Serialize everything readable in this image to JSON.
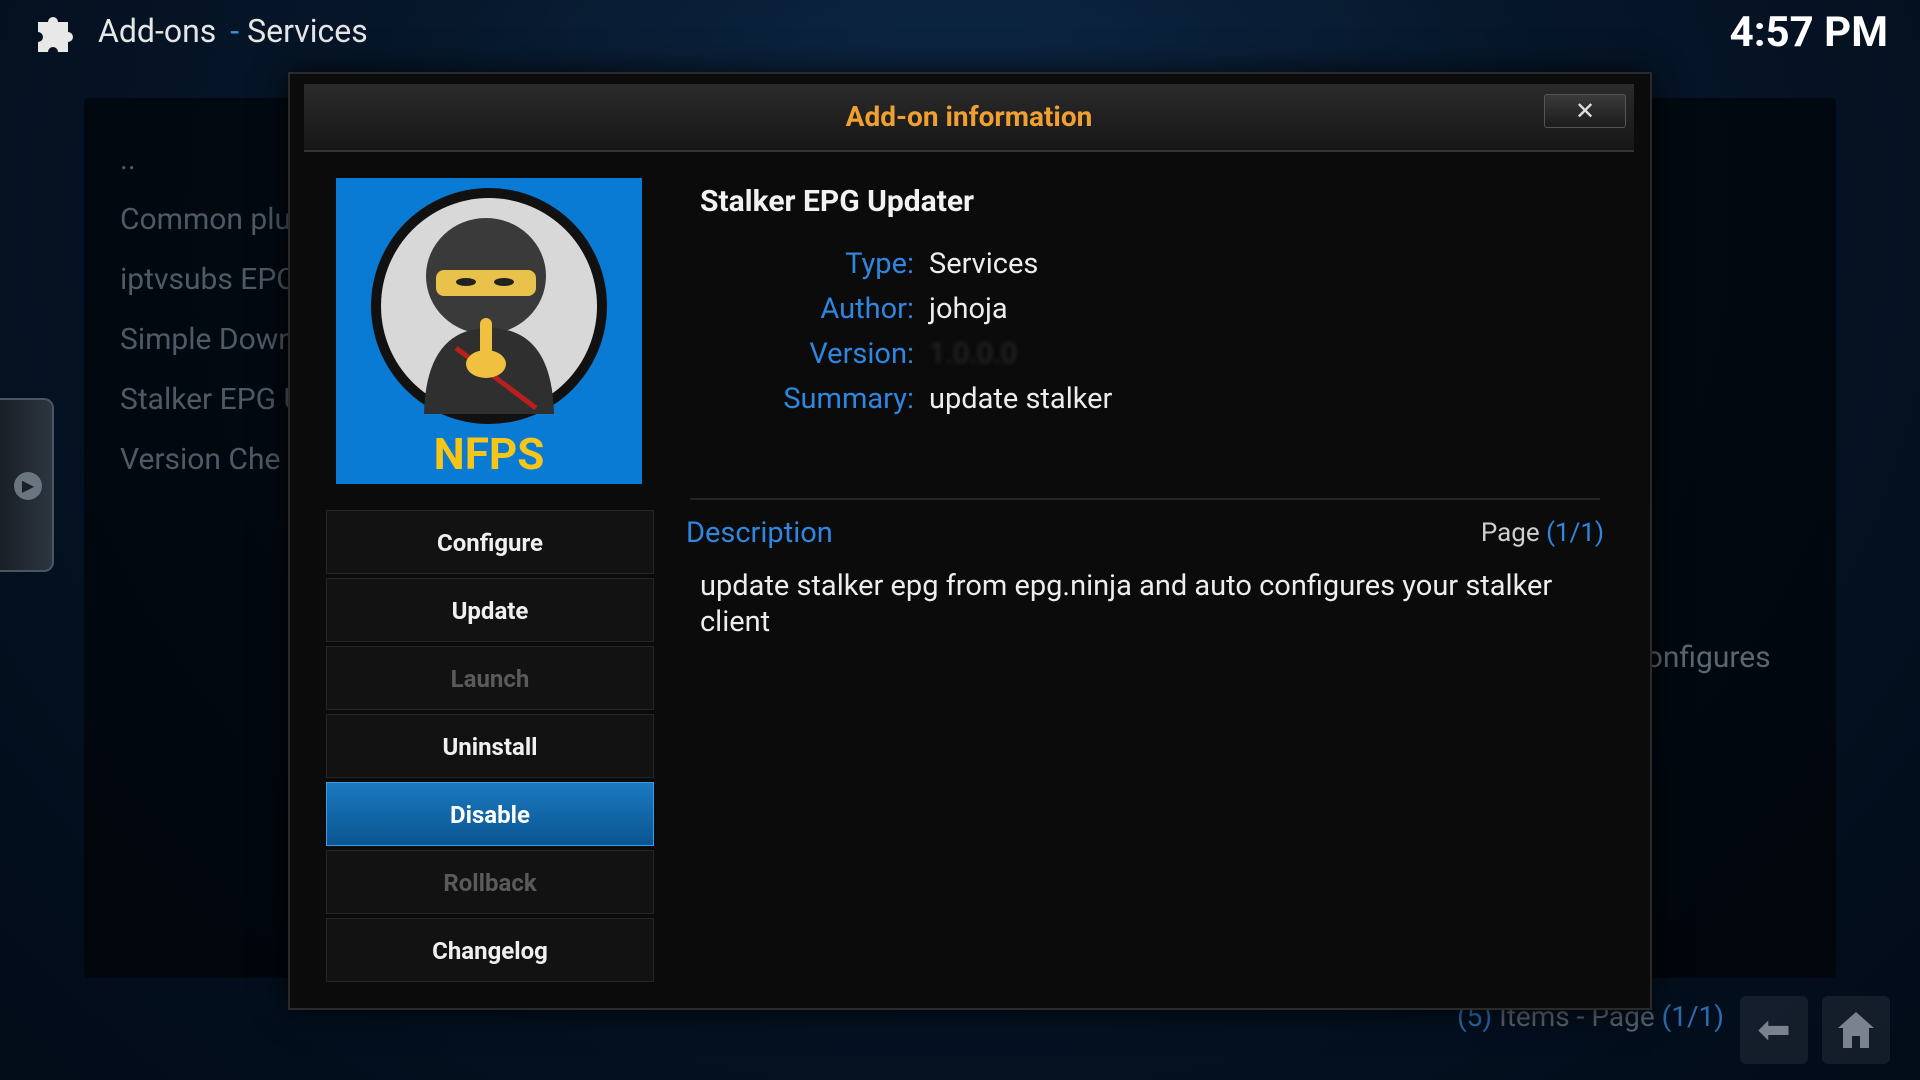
{
  "header": {
    "section": "Add-ons",
    "separator": "-",
    "subsection": "Services",
    "clock": "4:57 PM",
    "icon": "puzzle-piece-icon"
  },
  "background": {
    "list_items": [
      "..",
      "Common plu",
      "iptvsubs EPC",
      "Simple Down",
      "Stalker EPG U",
      "Version Che"
    ],
    "desc_fragment": "configures",
    "footer": {
      "count": "(5)",
      "items_text": "Items - Page",
      "page": "(1/1)"
    }
  },
  "dialog": {
    "title": "Add-on information",
    "close_label": "✕",
    "icon_text": "NFPS",
    "addon_name": "Stalker EPG Updater",
    "meta": {
      "type_label": "Type:",
      "type_value": "Services",
      "author_label": "Author:",
      "author_value": "johoja",
      "version_label": "Version:",
      "version_value": "1.0.0.0",
      "summary_label": "Summary:",
      "summary_value": "update stalker"
    },
    "description_label": "Description",
    "page_prefix": "Page",
    "page_value": "(1/1)",
    "description": "update stalker epg from epg.ninja and auto configures your stalker client",
    "buttons": [
      {
        "label": "Configure",
        "state": "enabled"
      },
      {
        "label": "Update",
        "state": "enabled"
      },
      {
        "label": "Launch",
        "state": "disabled"
      },
      {
        "label": "Uninstall",
        "state": "enabled"
      },
      {
        "label": "Disable",
        "state": "focused"
      },
      {
        "label": "Rollback",
        "state": "disabled"
      },
      {
        "label": "Changelog",
        "state": "enabled"
      }
    ]
  },
  "colors": {
    "accent_blue": "#2f86de",
    "title_orange": "#f0a030",
    "focus_blue": "#1b79c0",
    "icon_bg": "#0a7bd4",
    "nfps_yellow": "#f5c518"
  }
}
